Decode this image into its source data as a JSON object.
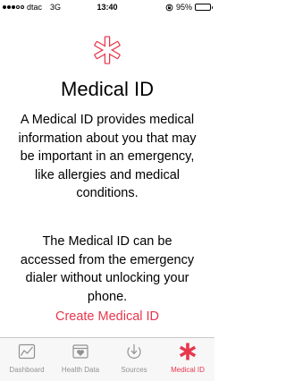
{
  "status_bar": {
    "carrier": "dtac",
    "network": "3G",
    "time": "13:40",
    "battery": "95%",
    "battery_level": 0.95,
    "signal_bars": 3
  },
  "hero": {
    "icon": "medical-asterisk-icon",
    "title": "Medical ID",
    "description": "A Medical ID provides medical information about you that may be important in an emergency, like allergies and medical conditions.",
    "access_note": "The Medical ID can be accessed from the emergency dialer without unlocking your phone.",
    "create_label": "Create Medical ID"
  },
  "tabs": [
    {
      "label": "Dashboard",
      "icon": "dashboard-icon",
      "active": false
    },
    {
      "label": "Health Data",
      "icon": "health-data-icon",
      "active": false
    },
    {
      "label": "Sources",
      "icon": "sources-icon",
      "active": false
    },
    {
      "label": "Medical ID",
      "icon": "medical-id-icon",
      "active": true
    }
  ],
  "colors": {
    "accent": "#e8374d",
    "inactive_tab": "#929292",
    "tab_bar_bg": "#f7f7f7"
  }
}
